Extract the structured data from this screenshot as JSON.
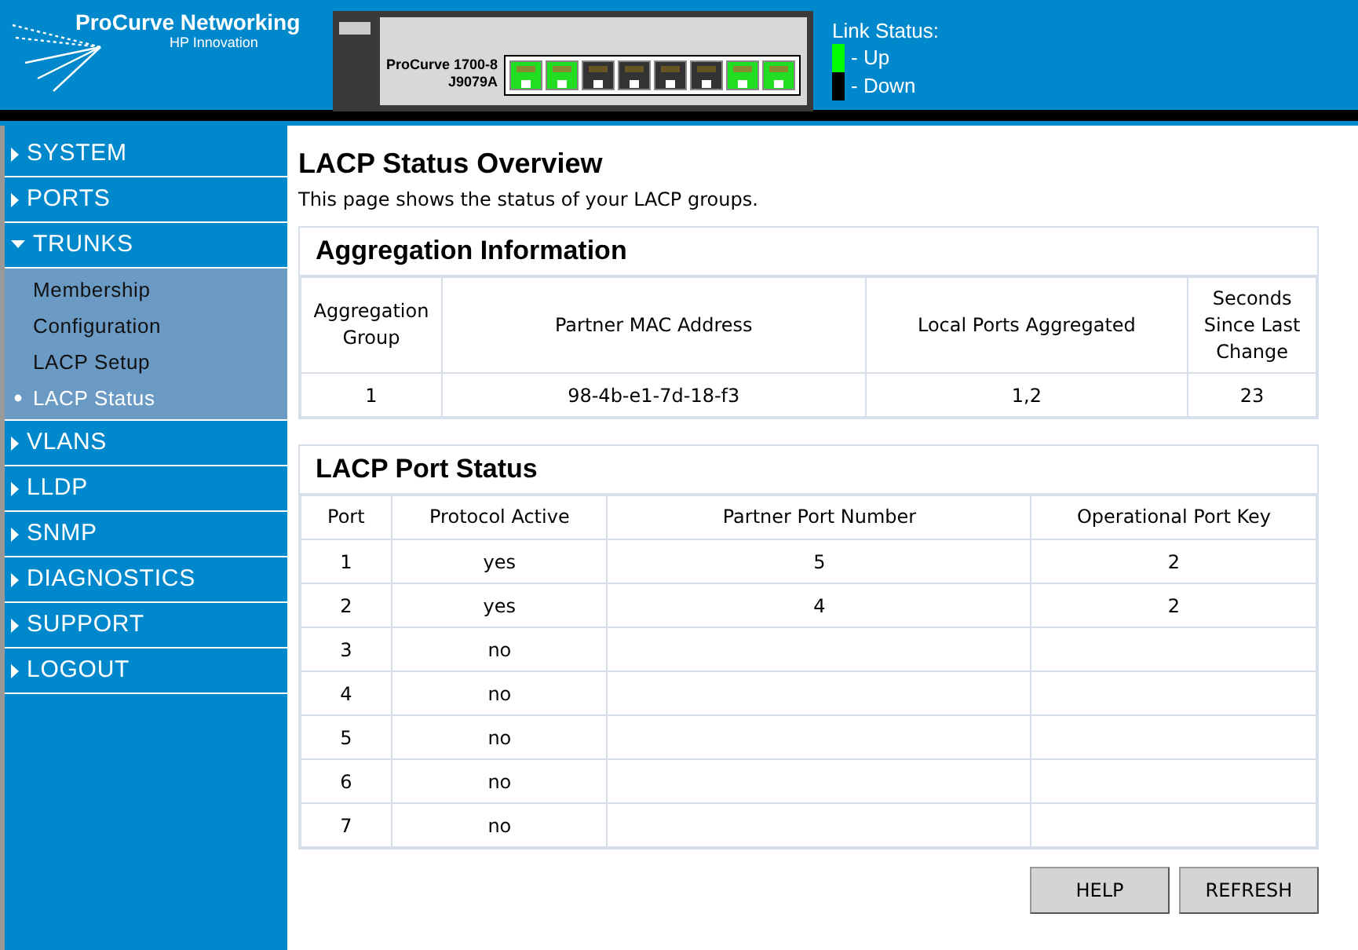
{
  "header": {
    "logo_title": "ProCurve Networking",
    "logo_subtitle": "HP Innovation",
    "device": {
      "model": "ProCurve 1700-8",
      "part_number": "J9079A",
      "ports": [
        {
          "up": true
        },
        {
          "up": true
        },
        {
          "up": false
        },
        {
          "up": false
        },
        {
          "up": false
        },
        {
          "up": false
        },
        {
          "up": true
        },
        {
          "up": true
        }
      ]
    },
    "link_status": {
      "title": "Link Status:",
      "legend": [
        {
          "label": "- Up",
          "color": "#00ff00"
        },
        {
          "label": "- Down",
          "color": "#000000"
        }
      ]
    }
  },
  "sidebar": {
    "items": [
      {
        "label": "SYSTEM",
        "expanded": false
      },
      {
        "label": "PORTS",
        "expanded": false
      },
      {
        "label": "TRUNKS",
        "expanded": true,
        "children": [
          {
            "label": "Membership",
            "selected": false
          },
          {
            "label": "Configuration",
            "selected": false
          },
          {
            "label": "LACP Setup",
            "selected": false
          },
          {
            "label": "LACP Status",
            "selected": true
          }
        ]
      },
      {
        "label": "VLANS",
        "expanded": false
      },
      {
        "label": "LLDP",
        "expanded": false
      },
      {
        "label": "SNMP",
        "expanded": false
      },
      {
        "label": "DIAGNOSTICS",
        "expanded": false
      },
      {
        "label": "SUPPORT",
        "expanded": false
      },
      {
        "label": "LOGOUT",
        "expanded": false
      }
    ]
  },
  "page": {
    "title": "LACP Status Overview",
    "description": "This page shows the status of your LACP groups.",
    "aggregation": {
      "title": "Aggregation Information",
      "columns": [
        "Aggregation Group",
        "Partner MAC Address",
        "Local Ports Aggregated",
        "Seconds Since Last Change"
      ],
      "rows": [
        [
          "1",
          "98-4b-e1-7d-18-f3",
          "1,2",
          "23"
        ]
      ]
    },
    "port_status": {
      "title": "LACP Port Status",
      "columns": [
        "Port",
        "Protocol Active",
        "Partner Port Number",
        "Operational Port Key"
      ],
      "rows": [
        [
          "1",
          "yes",
          "5",
          "2"
        ],
        [
          "2",
          "yes",
          "4",
          "2"
        ],
        [
          "3",
          "no",
          "",
          ""
        ],
        [
          "4",
          "no",
          "",
          ""
        ],
        [
          "5",
          "no",
          "",
          ""
        ],
        [
          "6",
          "no",
          "",
          ""
        ],
        [
          "7",
          "no",
          "",
          ""
        ]
      ]
    },
    "buttons": [
      "HELP",
      "REFRESH"
    ]
  }
}
